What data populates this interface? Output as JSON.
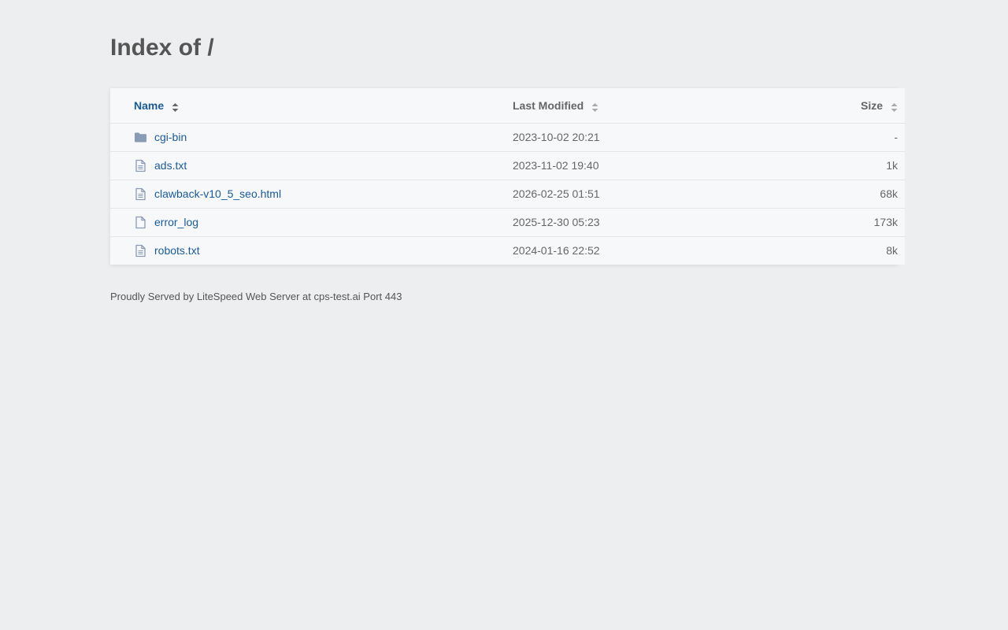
{
  "page": {
    "title": "Index of /"
  },
  "table": {
    "headers": {
      "name": "Name",
      "modified": "Last Modified",
      "size": "Size"
    },
    "rows": [
      {
        "icon": "folder-icon",
        "name": "cgi-bin",
        "modified": "2023-10-02 20:21",
        "size": "-"
      },
      {
        "icon": "text-file-icon",
        "name": "ads.txt",
        "modified": "2023-11-02 19:40",
        "size": "1k"
      },
      {
        "icon": "text-file-icon",
        "name": "clawback-v10_5_seo.html",
        "modified": "2026-02-25 01:51",
        "size": "68k"
      },
      {
        "icon": "file-icon",
        "name": "error_log",
        "modified": "2025-12-30 05:23",
        "size": "173k"
      },
      {
        "icon": "text-file-icon",
        "name": "robots.txt",
        "modified": "2024-01-16 22:52",
        "size": "8k"
      }
    ]
  },
  "footer": {
    "text": "Proudly Served by LiteSpeed Web Server at cps-test.ai Port 443"
  },
  "colors": {
    "background": "#eceef0",
    "link": "#1a5a9c",
    "icon": "#8a9bb5"
  }
}
